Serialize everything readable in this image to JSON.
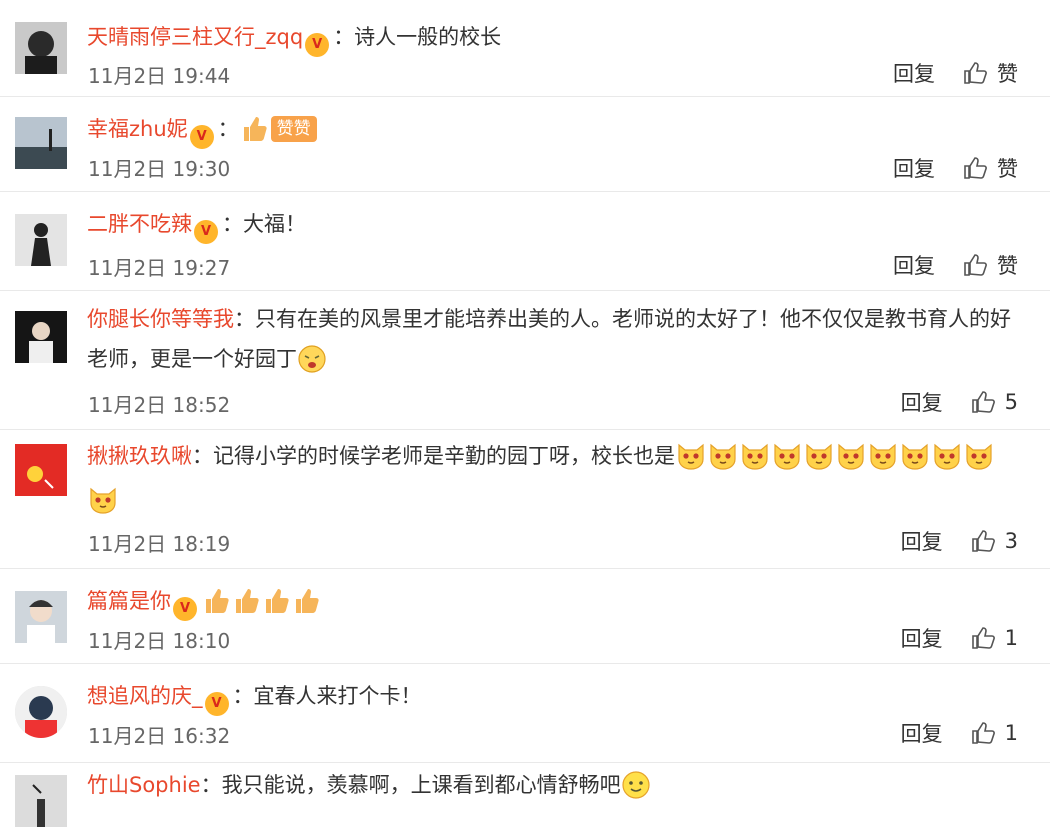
{
  "comments": [
    {
      "user": "天晴雨停三柱又行_zqq",
      "text": "：诗人一般的校长",
      "time": "11月2日 19:44",
      "reply": "回复",
      "like": "赞"
    },
    {
      "user": "幸福zhu妮",
      "text": "：",
      "tag": "赞赞",
      "time": "11月2日 19:30",
      "reply": "回复",
      "like": "赞"
    },
    {
      "user": "二胖不吃辣",
      "text": "：大福！",
      "time": "11月2日 19:27",
      "reply": "回复",
      "like": "赞"
    },
    {
      "user": "你腿长你等等我",
      "text": "：只有在美的风景里才能培养出美的人。老师说的太好了！他不仅仅是教书育人的好老师，更是一个好园丁",
      "time": "11月2日 18:52",
      "reply": "回复",
      "like": "5"
    },
    {
      "user": "揪揪玖玖啾",
      "text": "：记得小学的时候学老师是辛勤的园丁呀，校长也是",
      "time": "11月2日 18:19",
      "reply": "回复",
      "like": "3"
    },
    {
      "user": "篇篇是你",
      "time": "11月2日 18:10",
      "reply": "回复",
      "like": "1"
    },
    {
      "user": "想追风的庆_",
      "text": "：宜春人来打个卡！",
      "time": "11月2日 16:32",
      "reply": "回复",
      "like": "1"
    },
    {
      "user": "竹山Sophie",
      "text": "：我只能说，羡慕啊，上课看到都心情舒畅吧"
    }
  ],
  "colors": {
    "username": "#e8482d",
    "vip": "#ffb52b",
    "divider": "#e9e9e9"
  }
}
